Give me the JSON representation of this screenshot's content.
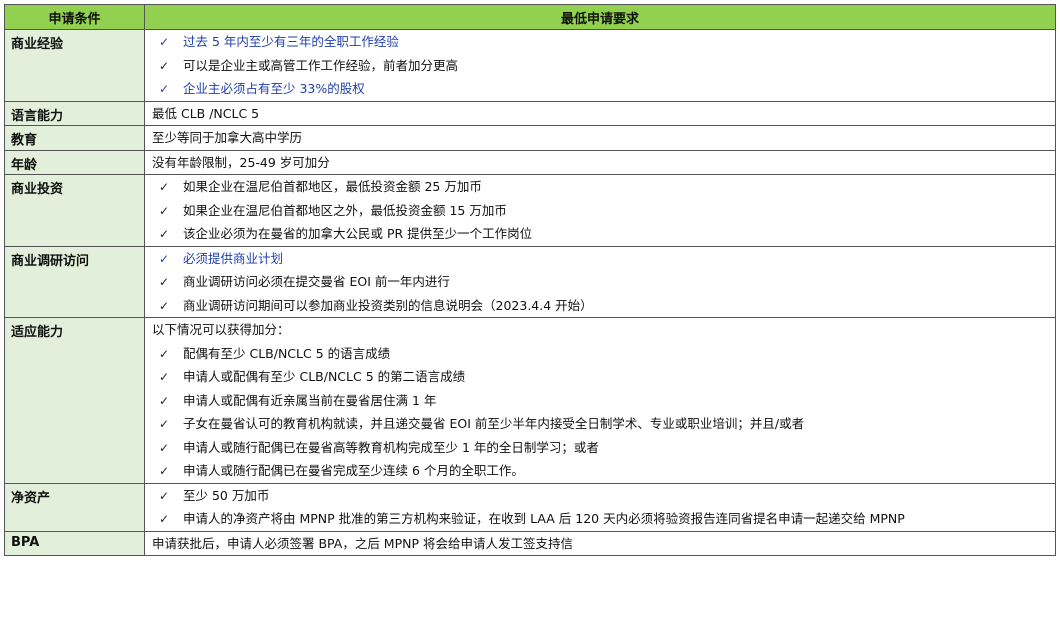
{
  "header": {
    "condition": "申请条件",
    "requirement": "最低申请要求"
  },
  "check_mark": "✓",
  "colors": {
    "header_bg": "#92d050",
    "label_bg": "#e2efda",
    "highlight_text": "#1f3fae",
    "border": "#555555"
  },
  "rows": [
    {
      "label": "商业经验",
      "lines": [
        {
          "text": "过去 5 年内至少有三年的全职工作经验",
          "blue": true
        },
        {
          "text": "可以是企业主或高管工作工作经验，前者加分更高",
          "blue": false
        },
        {
          "text": "企业主必须占有至少 33%的股权",
          "blue": true
        }
      ]
    },
    {
      "label": "语言能力",
      "plain": "最低 CLB /NCLC 5"
    },
    {
      "label": "教育",
      "plain": "至少等同于加拿大高中学历"
    },
    {
      "label": "年龄",
      "plain": "没有年龄限制，25-49 岁可加分"
    },
    {
      "label": "商业投资",
      "lines": [
        {
          "text": "如果企业在温尼伯首都地区，最低投资金额 25 万加币",
          "blue": false
        },
        {
          "text": "如果企业在温尼伯首都地区之外，最低投资金额 15 万加币",
          "blue": false
        },
        {
          "text": "该企业必须为在曼省的加拿大公民或 PR 提供至少一个工作岗位",
          "blue": false
        }
      ]
    },
    {
      "label": "商业调研访问",
      "lines": [
        {
          "text": "必须提供商业计划",
          "blue": true
        },
        {
          "text": "商业调研访问必须在提交曼省 EOI 前一年内进行",
          "blue": false
        },
        {
          "text": "商业调研访问期间可以参加商业投资类别的信息说明会（2023.4.4 开始）",
          "blue": false
        }
      ]
    },
    {
      "label": "适应能力",
      "intro": "以下情况可以获得加分：",
      "lines": [
        {
          "text": "配偶有至少 CLB/NCLC 5 的语言成绩",
          "blue": false
        },
        {
          "text": "申请人或配偶有至少 CLB/NCLC 5 的第二语言成绩",
          "blue": false
        },
        {
          "text": "申请人或配偶有近亲属当前在曼省居住满 1 年",
          "blue": false
        },
        {
          "text": "子女在曼省认可的教育机构就读，并且递交曼省 EOI 前至少半年内接受全日制学术、专业或职业培训；并且/或者",
          "blue": false
        },
        {
          "text": "申请人或随行配偶已在曼省高等教育机构完成至少 1 年的全日制学习；或者",
          "blue": false
        },
        {
          "text": "申请人或随行配偶已在曼省完成至少连续 6 个月的全职工作。",
          "blue": false
        }
      ]
    },
    {
      "label": "净资产",
      "lines": [
        {
          "text": "至少 50 万加币",
          "blue": false
        },
        {
          "text": "申请人的净资产将由 MPNP 批准的第三方机构来验证，在收到 LAA 后 120 天内必须将验资报告连同省提名申请一起递交给 MPNP",
          "blue": false
        }
      ]
    },
    {
      "label": "BPA",
      "plain": "申请获批后，申请人必须签署 BPA，之后 MPNP 将会给申请人发工签支持信"
    }
  ]
}
